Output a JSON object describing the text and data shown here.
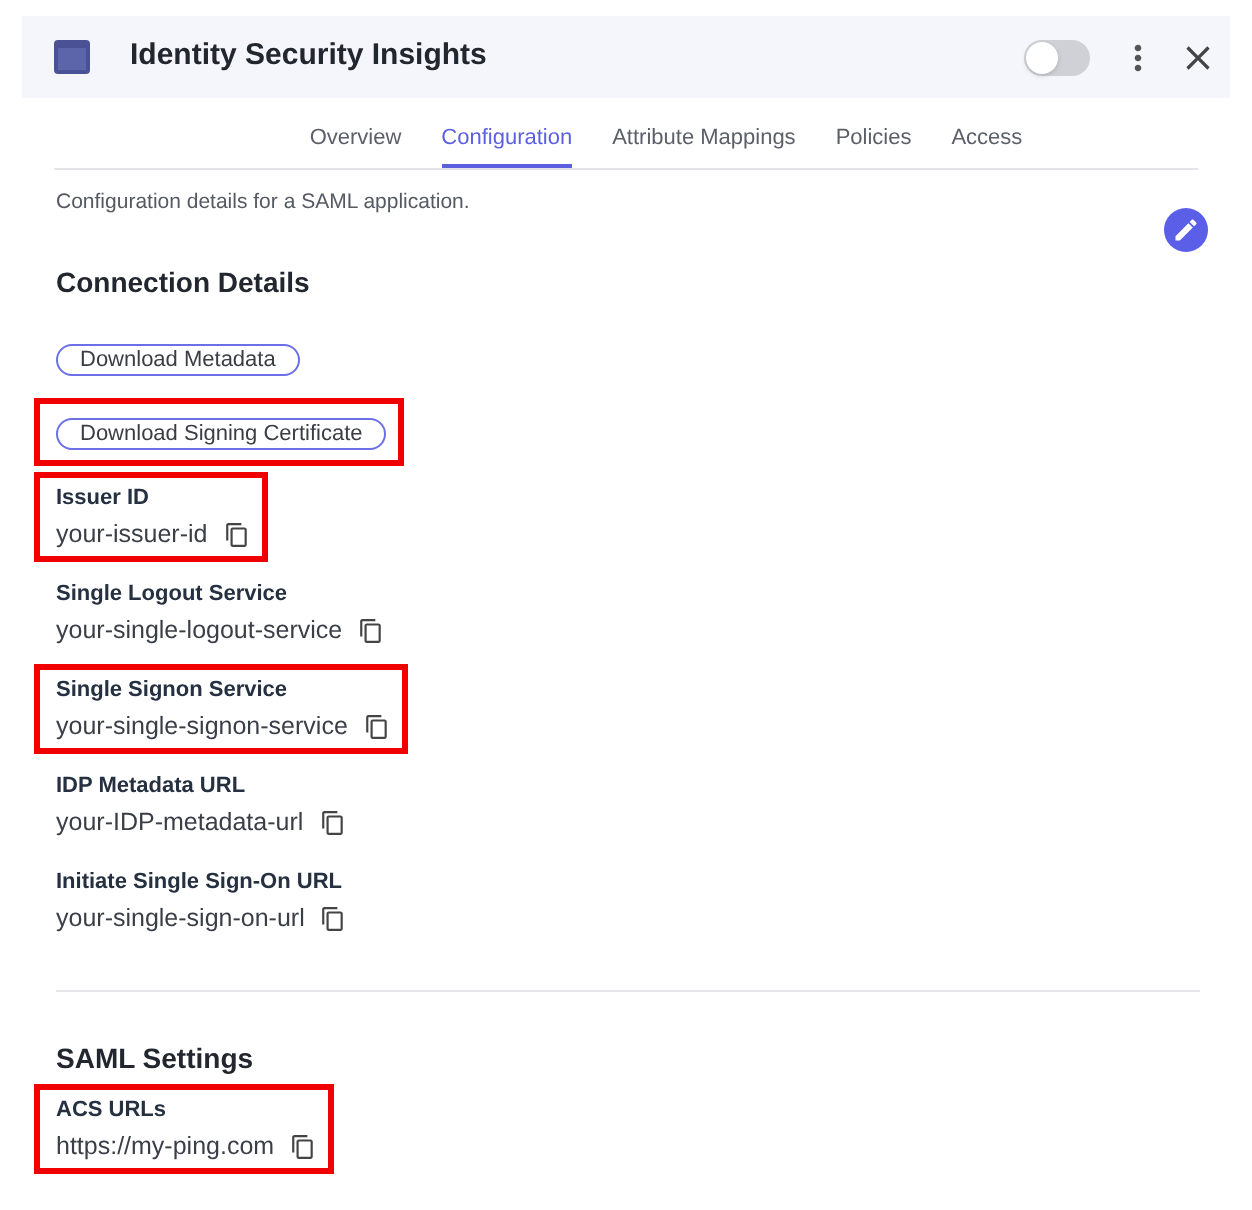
{
  "header": {
    "title": "Identity Security Insights",
    "enabled": false
  },
  "tabs": [
    {
      "label": "Overview",
      "selected": false
    },
    {
      "label": "Configuration",
      "selected": true
    },
    {
      "label": "Attribute Mappings",
      "selected": false
    },
    {
      "label": "Policies",
      "selected": false
    },
    {
      "label": "Access",
      "selected": false
    }
  ],
  "description": "Configuration details for a SAML application.",
  "sections": [
    {
      "title": "Connection Details",
      "items": [
        {
          "kind": "button",
          "label": "Download Metadata",
          "highlighted": false
        },
        {
          "kind": "button",
          "label": "Download Signing Certificate",
          "highlighted": true
        },
        {
          "kind": "field",
          "label": "Issuer ID",
          "value": "your-issuer-id",
          "highlighted": true
        },
        {
          "kind": "field",
          "label": "Single Logout Service",
          "value": "your-single-logout-service",
          "highlighted": false
        },
        {
          "kind": "field",
          "label": "Single Signon Service",
          "value": "your-single-signon-service",
          "highlighted": true
        },
        {
          "kind": "field",
          "label": "IDP Metadata URL",
          "value": "your-IDP-metadata-url",
          "highlighted": false
        },
        {
          "kind": "field",
          "label": "Initiate Single Sign-On URL",
          "value": "your-single-sign-on-url",
          "highlighted": false
        }
      ]
    },
    {
      "title": "SAML Settings",
      "items": [
        {
          "kind": "field",
          "label": "ACS URLs",
          "value": "https://my-ping.com",
          "highlighted": true
        }
      ]
    }
  ]
}
